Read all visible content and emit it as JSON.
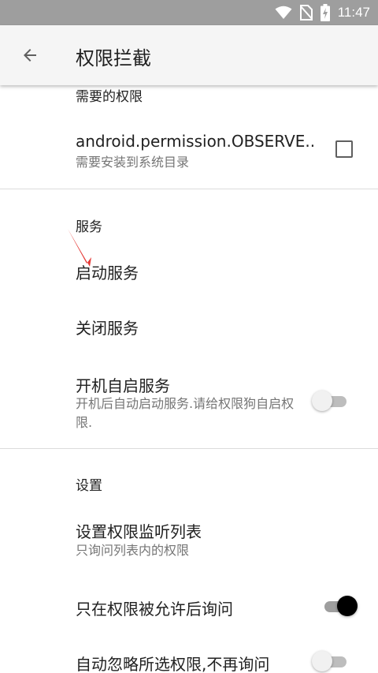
{
  "status_bar": {
    "time": "11:47"
  },
  "app_bar": {
    "title": "权限拦截"
  },
  "sections": {
    "required_permissions": {
      "header": "需要的权限",
      "item": {
        "title": "android.permission.OBSERVE..",
        "summary": "需要安装到系统目录",
        "checked": false
      }
    },
    "service": {
      "header": "服务",
      "start": "启动服务",
      "stop": "关闭服务",
      "autostart": {
        "title": "开机自启服务",
        "summary": "开机后自动启动服务.请给权限狗自启权限.",
        "enabled": false
      }
    },
    "settings": {
      "header": "设置",
      "watch_list": {
        "title": "设置权限监听列表",
        "summary": "只询问列表内的权限"
      },
      "ask_after_allowed": {
        "title": "只在权限被允许后询问",
        "enabled": true
      },
      "ignore_selected": {
        "title": "自动忽略所选权限,不再询问",
        "enabled": false
      }
    }
  },
  "colors": {
    "accent": "#000000",
    "annotation_arrow": "#e53935",
    "status_bar": "#9e9e9e"
  }
}
